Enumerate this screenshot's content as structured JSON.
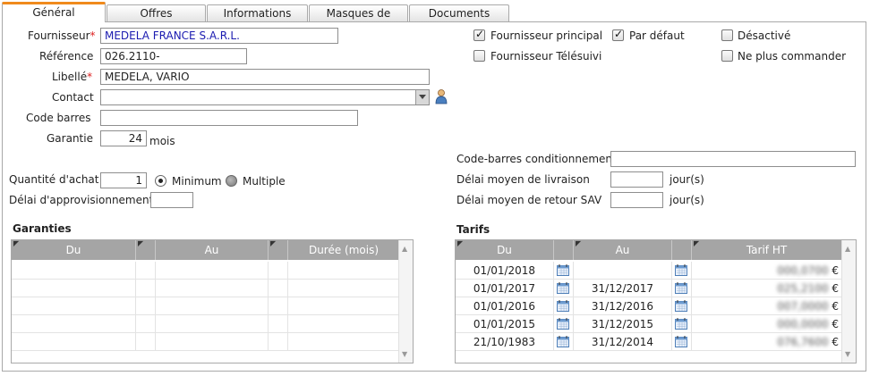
{
  "tabs": [
    {
      "label": "Général"
    },
    {
      "label": "Offres"
    },
    {
      "label": "Informations"
    },
    {
      "label": "Masques de saisie"
    },
    {
      "label": "Documents"
    }
  ],
  "form": {
    "fournisseur_label": "Fournisseur",
    "fournisseur_value": "MEDELA FRANCE S.A.R.L.",
    "reference_label": "Référence",
    "reference_value": "026.2110-",
    "libelle_label": "Libellé",
    "libelle_value": "MEDELA, VARIO",
    "contact_label": "Contact",
    "contact_value": "",
    "code_barres_label": "Code barres",
    "code_barres_value": "",
    "garantie_label": "Garantie",
    "garantie_value": "24",
    "garantie_unit": "mois",
    "qte_achat_label": "Quantité d'achat",
    "qte_achat_value": "1",
    "minimum_label": "Minimum",
    "multiple_label": "Multiple",
    "delai_appro_label": "Délai d'approvisionnement",
    "delai_appro_value": "",
    "required_mark": "*"
  },
  "options": {
    "fournisseur_principal": {
      "label": "Fournisseur principal",
      "checked": true
    },
    "par_defaut": {
      "label": "Par défaut",
      "checked": true
    },
    "desactive": {
      "label": "Désactivé",
      "checked": false
    },
    "fournisseur_telesuivi": {
      "label": "Fournisseur Télésuivi",
      "checked": false
    },
    "ne_plus_commander": {
      "label": "Ne plus commander",
      "checked": false
    }
  },
  "right_form": {
    "cb_cond_label": "Code-barres conditionnement",
    "cb_cond_value": "",
    "delai_livraison_label": "Délai moyen de livraison",
    "delai_livraison_value": "",
    "delai_livraison_unit": "jour(s)",
    "delai_retour_label": "Délai moyen de retour SAV",
    "delai_retour_value": "",
    "delai_retour_unit": "jour(s)"
  },
  "garanties": {
    "title": "Garanties",
    "columns": [
      "Du",
      "Au",
      "Durée (mois)"
    ]
  },
  "tarifs": {
    "title": "Tarifs",
    "columns": [
      "Du",
      "Au",
      "Tarif HT"
    ],
    "currency": "€",
    "rows": [
      {
        "du": "01/01/2018",
        "au": "",
        "tarif": "000,0700"
      },
      {
        "du": "01/01/2017",
        "au": "31/12/2017",
        "tarif": "025,2100"
      },
      {
        "du": "01/01/2016",
        "au": "31/12/2016",
        "tarif": "007,0000"
      },
      {
        "du": "01/01/2015",
        "au": "31/12/2015",
        "tarif": "000,0000"
      },
      {
        "du": "21/10/1983",
        "au": "31/12/2014",
        "tarif": "076,7600"
      }
    ]
  },
  "colors": {
    "active_tab_accent": "#f08a1c",
    "required": "#dd2222",
    "header_bg": "#a5a5a5"
  }
}
